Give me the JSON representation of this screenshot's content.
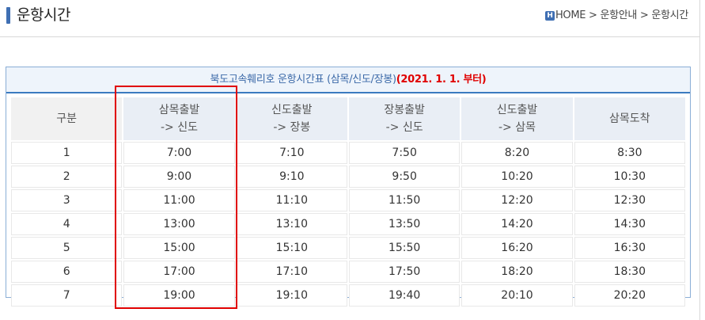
{
  "page": {
    "title": "운항시간"
  },
  "breadcrumb": {
    "home_icon": "H",
    "home": "HOME",
    "sep1": " > ",
    "section": "운항안내",
    "sep2": " > ",
    "current": "운항시간"
  },
  "schedule": {
    "caption_main": "북도고속훼리호 운항시간표 (삼목/신도/장봉)",
    "caption_date": "(2021. 1. 1. 부터)",
    "header_first": "구분",
    "columns": [
      {
        "line1": "삼목출발",
        "line2": "-> 신도"
      },
      {
        "line1": "신도출발",
        "line2": "-> 장봉"
      },
      {
        "line1": "장봉출발",
        "line2": "-> 신도"
      },
      {
        "line1": "신도출발",
        "line2": "-> 삼목"
      },
      {
        "line1": "삼목도착",
        "line2": ""
      }
    ],
    "rows": [
      {
        "no": "1",
        "times": [
          "7:00",
          "7:10",
          "7:50",
          "8:20",
          "8:30"
        ]
      },
      {
        "no": "2",
        "times": [
          "9:00",
          "9:10",
          "9:50",
          "10:20",
          "10:30"
        ]
      },
      {
        "no": "3",
        "times": [
          "11:00",
          "11:10",
          "11:50",
          "12:20",
          "12:30"
        ]
      },
      {
        "no": "4",
        "times": [
          "13:00",
          "13:10",
          "13:50",
          "14:20",
          "14:30"
        ]
      },
      {
        "no": "5",
        "times": [
          "15:00",
          "15:10",
          "15:50",
          "16:20",
          "16:30"
        ]
      },
      {
        "no": "6",
        "times": [
          "17:00",
          "17:10",
          "17:50",
          "18:20",
          "18:30"
        ]
      },
      {
        "no": "7",
        "times": [
          "19:00",
          "19:10",
          "19:40",
          "20:10",
          "20:20"
        ]
      }
    ]
  },
  "colors": {
    "accent": "#3f6fb3",
    "caption_text": "#3b69a8",
    "caption_date": "#e00000",
    "highlight": "#e00000"
  }
}
